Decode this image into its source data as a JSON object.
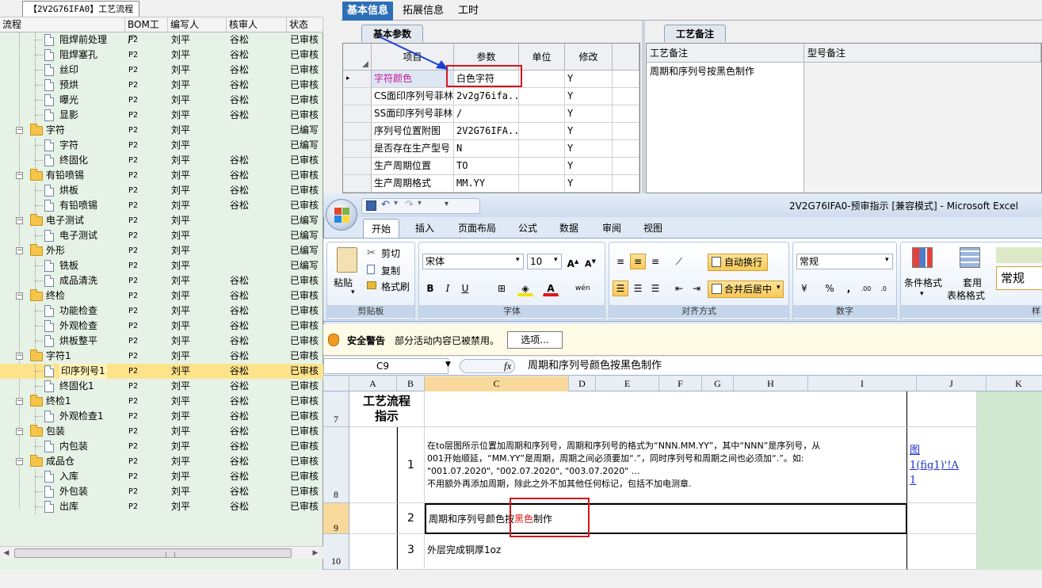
{
  "left_panel": {
    "title": "【2V2G76IFA0】工艺流程",
    "columns": [
      "流程",
      "BOM工厂",
      "编写人",
      "核审人",
      "状态"
    ],
    "rows": [
      {
        "level": 2,
        "type": "item",
        "name": "阻焊前处理",
        "bom": "P2",
        "writer": "刘平",
        "reviewer": "谷松",
        "status": "已审核"
      },
      {
        "level": 2,
        "type": "item",
        "name": "阻焊塞孔",
        "bom": "P2",
        "writer": "刘平",
        "reviewer": "谷松",
        "status": "已审核"
      },
      {
        "level": 2,
        "type": "item",
        "name": "丝印",
        "bom": "P2",
        "writer": "刘平",
        "reviewer": "谷松",
        "status": "已审核"
      },
      {
        "level": 2,
        "type": "item",
        "name": "预烘",
        "bom": "P2",
        "writer": "刘平",
        "reviewer": "谷松",
        "status": "已审核"
      },
      {
        "level": 2,
        "type": "item",
        "name": "曝光",
        "bom": "P2",
        "writer": "刘平",
        "reviewer": "谷松",
        "status": "已审核"
      },
      {
        "level": 2,
        "type": "item",
        "name": "显影",
        "bom": "P2",
        "writer": "刘平",
        "reviewer": "谷松",
        "status": "已审核"
      },
      {
        "level": 1,
        "type": "folder",
        "name": "字符",
        "bom": "P2",
        "writer": "刘平",
        "reviewer": "",
        "status": "已编写"
      },
      {
        "level": 2,
        "type": "item",
        "name": "字符",
        "bom": "P2",
        "writer": "刘平",
        "reviewer": "",
        "status": "已编写"
      },
      {
        "level": 2,
        "type": "item",
        "name": "终固化",
        "bom": "P2",
        "writer": "刘平",
        "reviewer": "谷松",
        "status": "已审核"
      },
      {
        "level": 1,
        "type": "folder",
        "name": "有铅喷锡",
        "bom": "P2",
        "writer": "刘平",
        "reviewer": "谷松",
        "status": "已审核"
      },
      {
        "level": 2,
        "type": "item",
        "name": "烘板",
        "bom": "P2",
        "writer": "刘平",
        "reviewer": "谷松",
        "status": "已审核"
      },
      {
        "level": 2,
        "type": "item",
        "name": "有铅喷锡",
        "bom": "P2",
        "writer": "刘平",
        "reviewer": "谷松",
        "status": "已审核"
      },
      {
        "level": 1,
        "type": "folder",
        "name": "电子测试",
        "bom": "P2",
        "writer": "刘平",
        "reviewer": "",
        "status": "已编写"
      },
      {
        "level": 2,
        "type": "item",
        "name": "电子测试",
        "bom": "P2",
        "writer": "刘平",
        "reviewer": "",
        "status": "已编写"
      },
      {
        "level": 1,
        "type": "folder",
        "name": "外形",
        "bom": "P2",
        "writer": "刘平",
        "reviewer": "",
        "status": "已编写"
      },
      {
        "level": 2,
        "type": "item",
        "name": "铣板",
        "bom": "P2",
        "writer": "刘平",
        "reviewer": "",
        "status": "已编写"
      },
      {
        "level": 2,
        "type": "item",
        "name": "成品清洗",
        "bom": "P2",
        "writer": "刘平",
        "reviewer": "谷松",
        "status": "已审核"
      },
      {
        "level": 1,
        "type": "folder",
        "name": "终检",
        "bom": "P2",
        "writer": "刘平",
        "reviewer": "谷松",
        "status": "已审核"
      },
      {
        "level": 2,
        "type": "item",
        "name": "功能检查",
        "bom": "P2",
        "writer": "刘平",
        "reviewer": "谷松",
        "status": "已审核"
      },
      {
        "level": 2,
        "type": "item",
        "name": "外观检查",
        "bom": "P2",
        "writer": "刘平",
        "reviewer": "谷松",
        "status": "已审核"
      },
      {
        "level": 2,
        "type": "item",
        "name": "烘板整平",
        "bom": "P2",
        "writer": "刘平",
        "reviewer": "谷松",
        "status": "已审核"
      },
      {
        "level": 1,
        "type": "folder",
        "name": "字符1",
        "bom": "P2",
        "writer": "刘平",
        "reviewer": "谷松",
        "status": "已审核"
      },
      {
        "level": 2,
        "type": "item",
        "name": "印序列号1",
        "bom": "P2",
        "writer": "刘平",
        "reviewer": "谷松",
        "status": "已审核",
        "selected": true
      },
      {
        "level": 2,
        "type": "item",
        "name": "终固化1",
        "bom": "P2",
        "writer": "刘平",
        "reviewer": "谷松",
        "status": "已审核"
      },
      {
        "level": 1,
        "type": "folder",
        "name": "终检1",
        "bom": "P2",
        "writer": "刘平",
        "reviewer": "谷松",
        "status": "已审核"
      },
      {
        "level": 2,
        "type": "item",
        "name": "外观检查1",
        "bom": "P2",
        "writer": "刘平",
        "reviewer": "谷松",
        "status": "已审核"
      },
      {
        "level": 1,
        "type": "folder",
        "name": "包装",
        "bom": "P2",
        "writer": "刘平",
        "reviewer": "谷松",
        "status": "已审核"
      },
      {
        "level": 2,
        "type": "item",
        "name": "内包装",
        "bom": "P2",
        "writer": "刘平",
        "reviewer": "谷松",
        "status": "已审核"
      },
      {
        "level": 1,
        "type": "folder",
        "name": "成品仓",
        "bom": "P2",
        "writer": "刘平",
        "reviewer": "谷松",
        "status": "已审核"
      },
      {
        "level": 2,
        "type": "item",
        "name": "入库",
        "bom": "P2",
        "writer": "刘平",
        "reviewer": "谷松",
        "status": "已审核"
      },
      {
        "level": 2,
        "type": "item",
        "name": "外包装",
        "bom": "P2",
        "writer": "刘平",
        "reviewer": "谷松",
        "status": "已审核"
      },
      {
        "level": 2,
        "type": "item",
        "name": "出库",
        "bom": "P2",
        "writer": "刘平",
        "reviewer": "谷松",
        "status": "已审核"
      }
    ]
  },
  "main_tabs": [
    "基本信息",
    "拓展信息",
    "工时"
  ],
  "params": {
    "tab": "基本参数",
    "columns": [
      "项目",
      "参数",
      "单位",
      "修改"
    ],
    "rows": [
      {
        "item": "字符颜色",
        "param": "白色字符",
        "unit": "",
        "modify": "Y",
        "current": true
      },
      {
        "item": "CS面印序列号菲林",
        "param": "2v2g76ifa...",
        "unit": "",
        "modify": "Y"
      },
      {
        "item": "SS面印序列号菲林",
        "param": "/",
        "unit": "",
        "modify": "Y"
      },
      {
        "item": "序列号位置附图",
        "param": "2V2G76IFA...",
        "unit": "",
        "modify": "Y"
      },
      {
        "item": "是否存在生产型号",
        "param": "N",
        "unit": "",
        "modify": "Y"
      },
      {
        "item": "生产周期位置",
        "param": "TO",
        "unit": "",
        "modify": "Y"
      },
      {
        "item": "生产周期格式",
        "param": "MM.YY",
        "unit": "",
        "modify": "Y"
      }
    ]
  },
  "notes": {
    "tab": "工艺备注",
    "columns": [
      "工艺备注",
      "型号备注"
    ],
    "process_note": "周期和序列号按黑色制作",
    "model_note": ""
  },
  "excel": {
    "title": "2V2G76IFA0-预审指示  [兼容模式] - Microsoft Excel",
    "ribbon_tabs": [
      "开始",
      "插入",
      "页面布局",
      "公式",
      "数据",
      "审阅",
      "视图"
    ],
    "clipboard": {
      "paste": "粘贴",
      "cut": "剪切",
      "copy": "复制",
      "format_painter": "格式刷",
      "label": "剪贴板"
    },
    "font": {
      "name": "宋体",
      "size": "10",
      "label": "字体"
    },
    "alignment": {
      "wrap": "自动换行",
      "merge": "合并后居中",
      "label": "对齐方式"
    },
    "number": {
      "format": "常规",
      "label": "数字"
    },
    "styles": {
      "conditional": "条件格式",
      "table_format_1": "套用",
      "table_format_2": "表格格式",
      "cell_style": "常规",
      "label": "样"
    },
    "security": {
      "title": "安全警告",
      "message": "部分活动内容已被禁用。",
      "options": "选项..."
    },
    "formula_bar": {
      "name_box": "C9",
      "fx": "fx",
      "content": "周期和序列号颜色按黑色制作"
    },
    "columns": [
      "A",
      "B",
      "C",
      "D",
      "E",
      "F",
      "G",
      "H",
      "I",
      "J",
      "K"
    ],
    "rows": {
      "r7": {
        "num": "7",
        "title_line1": "工艺流程",
        "title_line2": "指示"
      },
      "r8": {
        "num": "8",
        "step": "1",
        "text1": "在to层图所示位置加周期和序列号，周期和序列号的格式为“NNN.MM.YY”，其中“NNN”是序列号，从",
        "text2": "001开始顺延，“MM.YY”是周期，周期之间必须要加“.”，同时序列号和周期之间也必须加“.”。如:",
        "text3": "\"001.07.2020\", \"002.07.2020\", \"003.07.2020\" …",
        "text4": "不用额外再添加周期，除此之外不加其他任何标记，包括不加电测章.",
        "link1": "图",
        "link2": "1(fig1)'!A",
        "link3": "1"
      },
      "r9": {
        "num": "9",
        "step": "2",
        "text_pre": "周期和序列号颜色按",
        "text_red": "黑色",
        "text_post": "制作"
      },
      "r10": {
        "num": "10",
        "step": "3",
        "text": "外层完成铜厚1oz"
      }
    }
  }
}
